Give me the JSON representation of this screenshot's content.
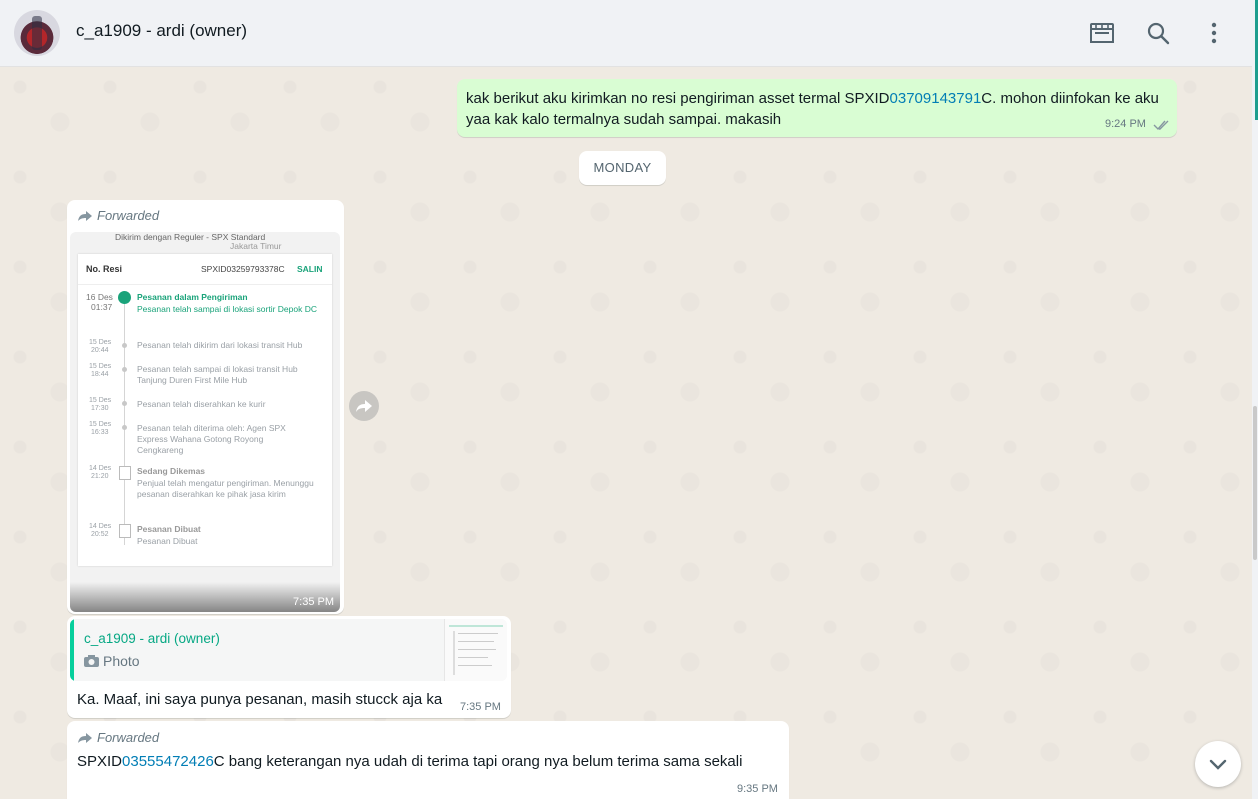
{
  "header": {
    "contact_name": "c_a1909 - ardi (owner)",
    "icons": [
      "shop-icon",
      "search-icon",
      "menu-icon"
    ]
  },
  "messages": {
    "outgoing": {
      "text_before": "kak berikut aku kirimkan no resi pengiriman asset termal SPXID",
      "link": "03709143791",
      "text_after": "C. mohon diinfokan ke aku yaa kak kalo termalnya sudah sampai. makasih",
      "time": "9:24 PM"
    },
    "day_divider": "MONDAY",
    "forwarded_photo": {
      "forwarded_label": "Forwarded",
      "time": "7:35 PM",
      "screenshot": {
        "header_line": "Dikirim dengan Reguler - SPX Standard",
        "header_line2": "Jakarta Timur",
        "no_resi_label": "No. Resi",
        "no_resi_value": "SPXID03259793378C",
        "copy_label": "SALIN",
        "events": [
          {
            "date": "16 Des",
            "time": "01:37",
            "title": "Pesanan dalam Pengiriman",
            "desc": "Pesanan telah sampai di lokasi sortir Depok DC"
          },
          {
            "date": "15 Des",
            "time": "20:44",
            "title": "",
            "desc": "Pesanan telah dikirim dari lokasi transit Hub"
          },
          {
            "date": "15 Des",
            "time": "18:44",
            "title": "",
            "desc": "Pesanan telah sampai di lokasi transit Hub Tanjung Duren First Mile Hub"
          },
          {
            "date": "15 Des",
            "time": "17:30",
            "title": "",
            "desc": "Pesanan telah diserahkan ke kurir"
          },
          {
            "date": "15 Des",
            "time": "16:33",
            "title": "",
            "desc": "Pesanan telah diterima oleh: Agen SPX Express Wahana Gotong Royong Cengkareng"
          },
          {
            "date": "14 Des",
            "time": "21:20",
            "title": "Sedang Dikemas",
            "desc": "Penjual telah mengatur pengiriman. Menunggu pesanan diserahkan ke pihak jasa kirim"
          },
          {
            "date": "14 Des",
            "time": "20:52",
            "title": "Pesanan Dibuat",
            "desc": "Pesanan Dibuat"
          }
        ]
      }
    },
    "reply": {
      "quoted_name": "c_a1909 - ardi (owner)",
      "quoted_type": "Photo",
      "text": "Ka. Maaf, ini saya punya pesanan, masih stucck aja ka",
      "time": "7:35 PM"
    },
    "forwarded_text": {
      "forwarded_label": "Forwarded",
      "text_before": "SPXID",
      "link": "03555472426",
      "text_after": "C bang keterangan nya udah di terima tapi orang nya belum terima sama sekali",
      "time": "9:35 PM"
    }
  },
  "colors": {
    "chat_bg": "#efeae2",
    "outgoing_bubble": "#d9fdd3",
    "link": "#027eb5",
    "quote_accent": "#06cf9c"
  }
}
